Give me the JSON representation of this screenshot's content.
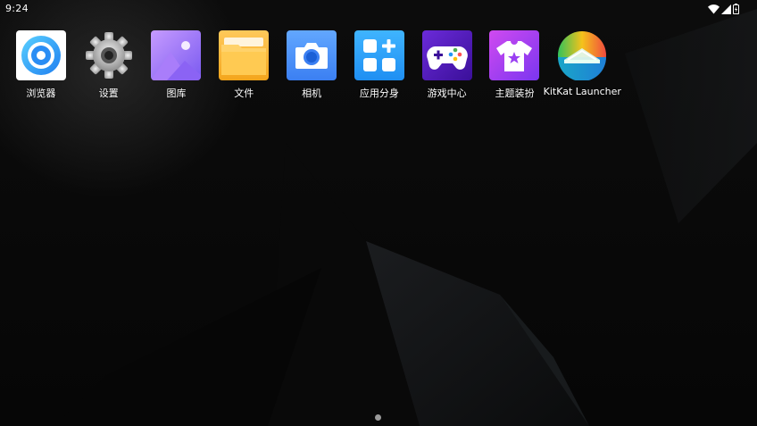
{
  "status_bar": {
    "time": "9:24",
    "icons": [
      "wifi-icon",
      "cell-signal-icon",
      "battery-icon"
    ]
  },
  "apps": [
    {
      "label": "浏览器",
      "icon": "browser-icon"
    },
    {
      "label": "设置",
      "icon": "gear-icon"
    },
    {
      "label": "图库",
      "icon": "gallery-icon"
    },
    {
      "label": "文件",
      "icon": "folder-icon"
    },
    {
      "label": "相机",
      "icon": "camera-icon"
    },
    {
      "label": "应用分身",
      "icon": "app-clone-icon"
    },
    {
      "label": "游戏中心",
      "icon": "gamepad-icon"
    },
    {
      "label": "主题装扮",
      "icon": "theme-shirt-icon"
    },
    {
      "label": "KitKat Launcher",
      "icon": "kitkat-launcher-icon"
    }
  ],
  "page_indicator": {
    "current": 1,
    "total": 1
  }
}
